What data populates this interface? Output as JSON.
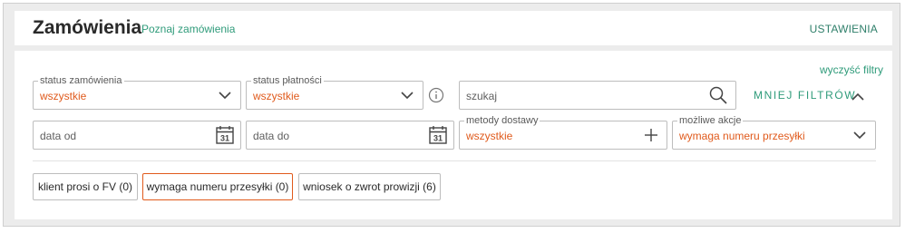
{
  "header": {
    "title": "Zamówienia",
    "learn_link": "Poznaj zamówienia",
    "settings": "USTAWIENIA"
  },
  "filters": {
    "clear_link": "wyczyść filtry",
    "order_status": {
      "label": "status zamówienia",
      "value": "wszystkie"
    },
    "payment_status": {
      "label": "status płatności",
      "value": "wszystkie"
    },
    "search": {
      "placeholder": "szukaj"
    },
    "less_filters": "MNIEJ FILTRÓW",
    "date_from": {
      "placeholder": "data od",
      "calendar_day": "31"
    },
    "date_to": {
      "placeholder": "data do",
      "calendar_day": "31"
    },
    "delivery_methods": {
      "label": "metody dostawy",
      "value": "wszystkie"
    },
    "possible_actions": {
      "label": "możliwe akcje",
      "value": "wymaga numeru przesyłki"
    }
  },
  "quick_filters": [
    {
      "label": "klient prosi o FV (0)",
      "active": false
    },
    {
      "label": "wymaga numeru przesyłki (0)",
      "active": true
    },
    {
      "label": "wniosek o zwrot prowizji (6)",
      "active": false
    }
  ],
  "colors": {
    "accent": "#2f9b7a",
    "selected_value": "#e05a1c",
    "background": "#ececec"
  },
  "icons": [
    "chevron-down-icon",
    "info-icon",
    "search-icon",
    "chevron-up-icon",
    "calendar-icon",
    "plus-icon"
  ]
}
